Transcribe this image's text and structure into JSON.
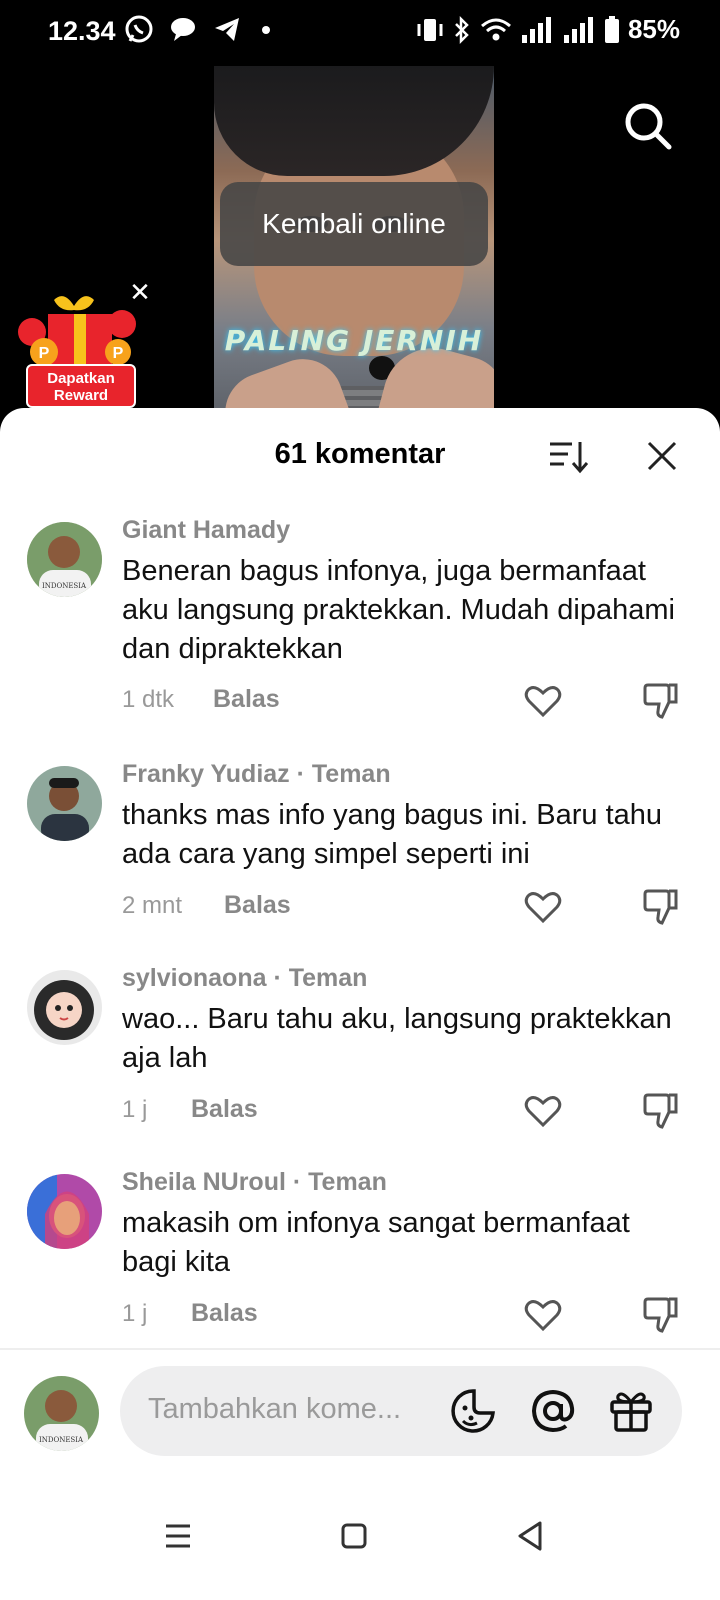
{
  "status_bar": {
    "time": "12.34",
    "battery": "85%",
    "left_icons": [
      "whatsapp-icon",
      "chat-bubble-icon",
      "telegram-icon",
      "dot-icon"
    ],
    "right_icons": [
      "vibrate-icon",
      "bluetooth-icon",
      "wifi-icon",
      "signal-icon",
      "signal-icon",
      "battery-icon"
    ]
  },
  "video": {
    "overlay_text": "PALING JERNIH"
  },
  "toast": {
    "text": "Kembali online"
  },
  "reward": {
    "label_line1": "Dapatkan",
    "label_line2": "Reward"
  },
  "sheet": {
    "title": "61 komentar"
  },
  "comments": [
    {
      "user": "Giant Hamady",
      "tag": "",
      "text": "Beneran bagus infonya, juga bermanfaat aku langsung praktekkan. Mudah dipahami dan dipraktekkan",
      "time": "1 dtk",
      "reply": "Balas"
    },
    {
      "user": "Franky Yudiaz",
      "tag": " · Teman",
      "text": "thanks mas info yang bagus ini. Baru tahu ada cara yang simpel seperti ini",
      "time": "2 mnt",
      "reply": "Balas"
    },
    {
      "user": "sylvionaona",
      "tag": " · Teman",
      "text": "wao... Baru tahu aku, langsung praktekkan aja lah",
      "time": "1 j",
      "reply": "Balas"
    },
    {
      "user": "Sheila NUroul",
      "tag": " · Teman",
      "text": "makasih om infonya sangat bermanfaat bagi kita",
      "time": "1 j",
      "reply": "Balas"
    }
  ],
  "input": {
    "placeholder": "Tambahkan kome..."
  },
  "avatar_text": "INDONESIA",
  "colors": {
    "accent_red": "#e8242c",
    "muted": "#888888",
    "sheet_bg": "#ffffff"
  }
}
